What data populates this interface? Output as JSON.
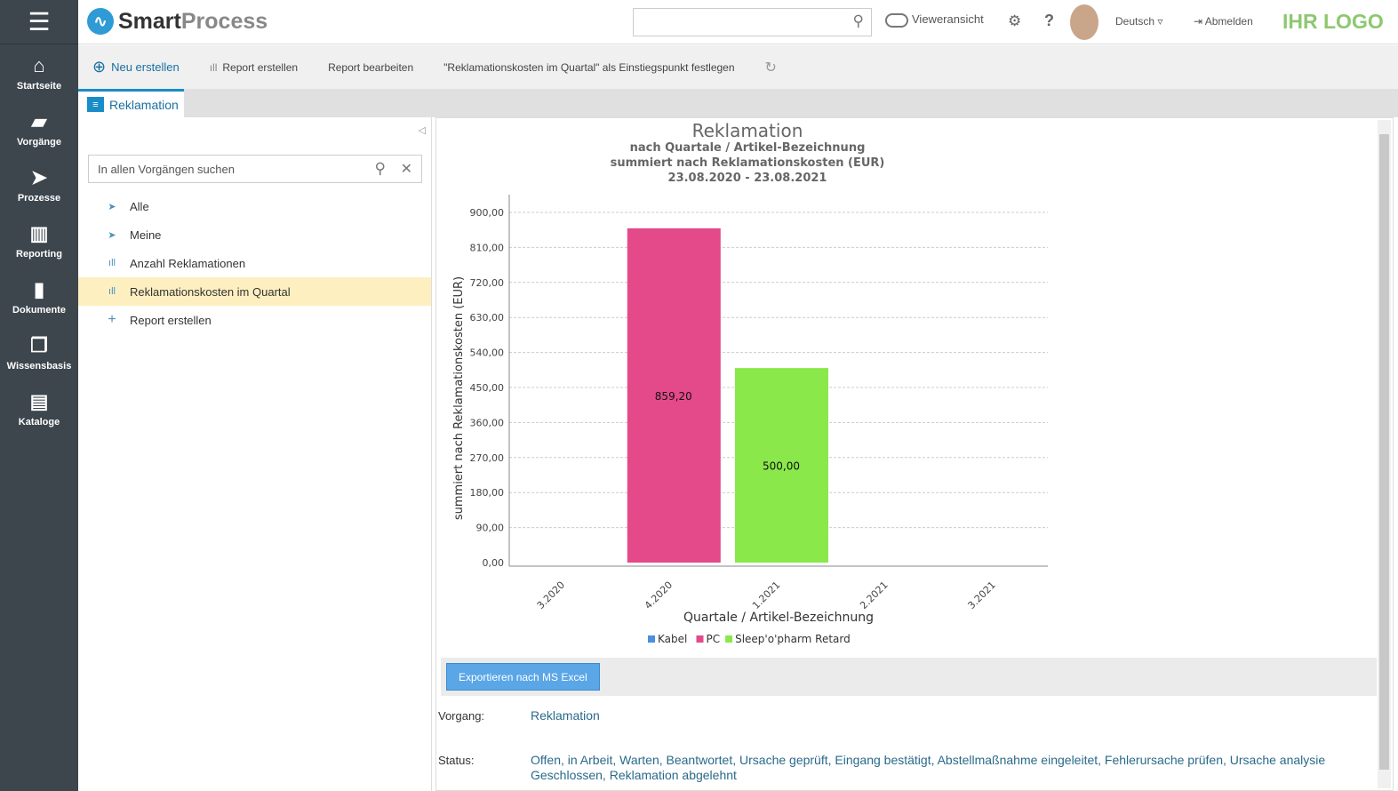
{
  "sidebar": {
    "items": [
      {
        "label": "Startseite",
        "icon": "home-icon"
      },
      {
        "label": "Vorgänge",
        "icon": "folder-icon"
      },
      {
        "label": "Prozesse",
        "icon": "process-icon"
      },
      {
        "label": "Reporting",
        "icon": "chart-icon"
      },
      {
        "label": "Dokumente",
        "icon": "document-icon"
      },
      {
        "label": "Wissensbasis",
        "icon": "copy-icon"
      },
      {
        "label": "Kataloge",
        "icon": "book-icon"
      }
    ]
  },
  "header": {
    "brand_a": "Smart",
    "brand_b": "Process",
    "viewer": "Vieweransicht",
    "language": "Deutsch",
    "logout": "Abmelden",
    "custom_logo": "IHR LOGO"
  },
  "toolbar": {
    "new": "Neu erstellen",
    "create_report": "Report erstellen",
    "edit_report": "Report bearbeiten",
    "set_entry": "\"Reklamationskosten im Quartal\" als Einstiegspunkt festlegen"
  },
  "tab": {
    "label": "Reklamation"
  },
  "left": {
    "search_placeholder": "In allen Vorgängen suchen",
    "items": [
      "Alle",
      "Meine",
      "Anzahl Reklamationen",
      "Reklamationskosten im Quartal",
      "Report erstellen"
    ]
  },
  "chart_data": {
    "type": "bar",
    "title": "Reklamation",
    "subtitle1": "nach Quartale / Artikel-Bezeichnung",
    "subtitle2": "summiert nach Reklamationskosten (EUR)",
    "subtitle3": "23.08.2020 - 23.08.2021",
    "xlabel": "Quartale / Artikel-Bezeichnung",
    "ylabel": "summiert nach Reklamationskosten (EUR)",
    "ylim": [
      0,
      900
    ],
    "yticks": [
      "0,00",
      "90,00",
      "180,00",
      "270,00",
      "360,00",
      "450,00",
      "540,00",
      "630,00",
      "720,00",
      "810,00",
      "900,00"
    ],
    "categories": [
      "3.2020",
      "4.2020",
      "1.2021",
      "2.2021",
      "3.2021"
    ],
    "series": [
      {
        "name": "Kabel",
        "color": "#4a8fe0",
        "values": [
          0,
          0,
          0,
          0,
          0
        ]
      },
      {
        "name": "PC",
        "color": "#e44a8a",
        "values": [
          0,
          859.2,
          0,
          0,
          0
        ]
      },
      {
        "name": "Sleep'o'pharm Retard",
        "color": "#8ae84a",
        "values": [
          0,
          0,
          500,
          0,
          0
        ]
      }
    ],
    "data_labels": {
      "pc": "859,20",
      "sleep": "500,00"
    },
    "legend": "bottom"
  },
  "detail": {
    "export": "Exportieren nach MS Excel",
    "vorgang_label": "Vorgang:",
    "vorgang": "Reklamation",
    "status_label": "Status:",
    "status": "Offen, in Arbeit, Warten, Beantwortet, Ursache geprüft, Eingang bestätigt, Abstellmaßnahme eingeleitet, Fehlerursache prüfen, Ursache analysie Geschlossen, Reklamation abgelehnt"
  }
}
